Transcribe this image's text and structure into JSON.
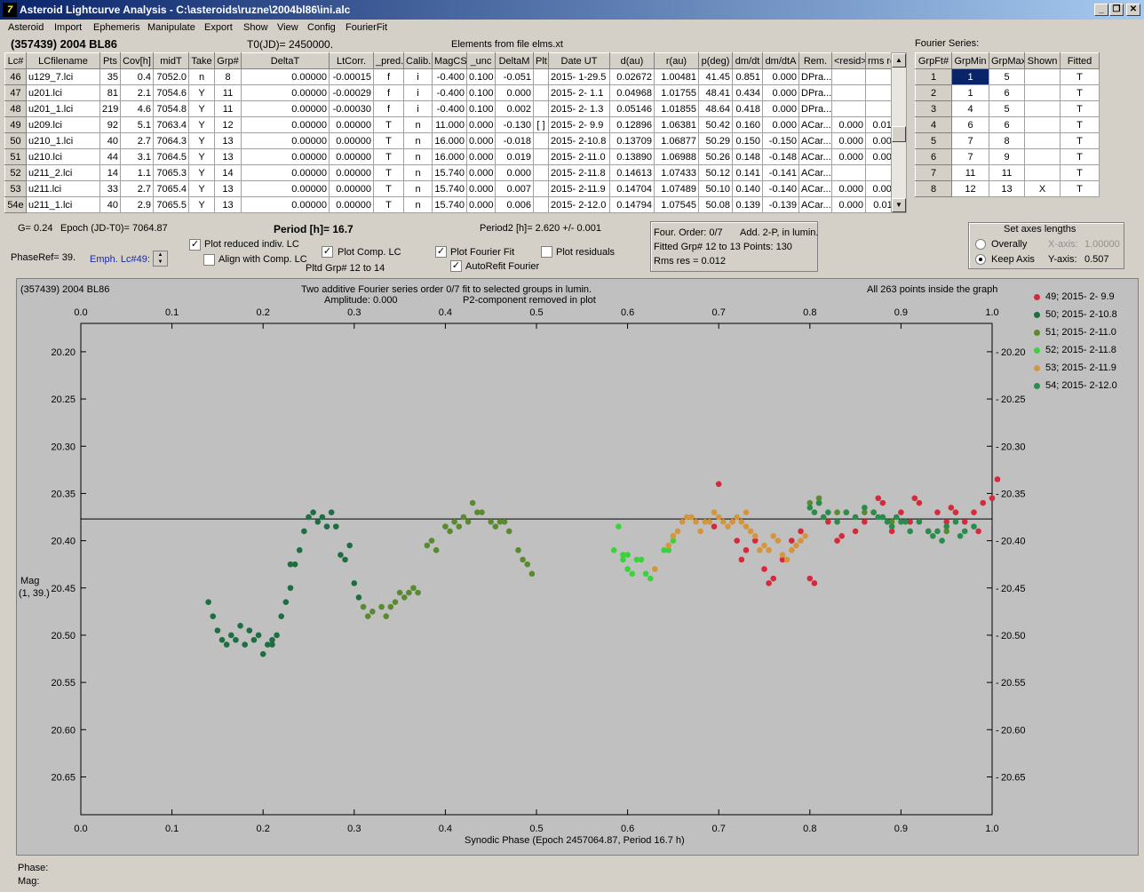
{
  "window": {
    "title": "Asteroid Lightcurve Analysis - C:\\asteroids\\ruzne\\2004bl86\\ini.alc",
    "icon": "app-icon"
  },
  "menu": [
    "Asteroid",
    "Import",
    "Ephemeris",
    "Manipulate",
    "Export",
    "Show",
    "View",
    "Config",
    "FourierFit"
  ],
  "header": {
    "asteroid": "(357439) 2004 BL86",
    "t0": "T0(JD)= 2450000.",
    "elements": "Elements from file elms.xt",
    "fourier_title": "Fourier Series:"
  },
  "lc_table": {
    "columns": [
      "Lc#",
      "LCfilename",
      "Pts",
      "Cov[h]",
      "midT",
      "Take",
      "Grp#",
      "DeltaT",
      "LtCorr.",
      "_pred.",
      "Calib.",
      "MagCS",
      "_unc",
      "DeltaM",
      "Plt",
      "Date UT",
      "d(au)",
      "r(au)",
      "p(deg)",
      "dm/dt",
      "dm/dtA",
      "Rem.",
      "<resid>",
      "rms res"
    ],
    "rows": [
      [
        "46",
        "u129_7.lci",
        "35",
        "0.4",
        "7052.0",
        "n",
        "8",
        "0.00000",
        "-0.00015",
        "f",
        "i",
        "-0.400",
        "0.100",
        "-0.051",
        "",
        "2015- 1-29.5",
        "0.02672",
        "1.00481",
        "41.45",
        "0.851",
        "0.000",
        "DPra...",
        "",
        ""
      ],
      [
        "47",
        "u201.lci",
        "81",
        "2.1",
        "7054.6",
        "Y",
        "11",
        "0.00000",
        "-0.00029",
        "f",
        "i",
        "-0.400",
        "0.100",
        "0.000",
        "",
        "2015- 2- 1.1",
        "0.04968",
        "1.01755",
        "48.41",
        "0.434",
        "0.000",
        "DPra...",
        "",
        ""
      ],
      [
        "48",
        "u201_1.lci",
        "219",
        "4.6",
        "7054.8",
        "Y",
        "11",
        "0.00000",
        "-0.00030",
        "f",
        "i",
        "-0.400",
        "0.100",
        "0.002",
        "",
        "2015- 2- 1.3",
        "0.05146",
        "1.01855",
        "48.64",
        "0.418",
        "0.000",
        "DPra...",
        "",
        ""
      ],
      [
        "49",
        "u209.lci",
        "92",
        "5.1",
        "7063.4",
        "Y",
        "12",
        "0.00000",
        "0.00000",
        "T",
        "n",
        "11.000",
        "0.000",
        "-0.130",
        "[ ]",
        "2015- 2- 9.9",
        "0.12896",
        "1.06381",
        "50.42",
        "0.160",
        "0.000",
        "ACar...",
        "0.000",
        "0.013"
      ],
      [
        "50",
        "u210_1.lci",
        "40",
        "2.7",
        "7064.3",
        "Y",
        "13",
        "0.00000",
        "0.00000",
        "T",
        "n",
        "16.000",
        "0.000",
        "-0.018",
        "",
        "2015- 2-10.8",
        "0.13709",
        "1.06877",
        "50.29",
        "0.150",
        "-0.150",
        "ACar...",
        "0.000",
        "0.002"
      ],
      [
        "51",
        "u210.lci",
        "44",
        "3.1",
        "7064.5",
        "Y",
        "13",
        "0.00000",
        "0.00000",
        "T",
        "n",
        "16.000",
        "0.000",
        "0.019",
        "",
        "2015- 2-11.0",
        "0.13890",
        "1.06988",
        "50.26",
        "0.148",
        "-0.148",
        "ACar...",
        "0.000",
        "0.007"
      ],
      [
        "52",
        "u211_2.lci",
        "14",
        "1.1",
        "7065.3",
        "Y",
        "14",
        "0.00000",
        "0.00000",
        "T",
        "n",
        "15.740",
        "0.000",
        "0.000",
        "",
        "2015- 2-11.8",
        "0.14613",
        "1.07433",
        "50.12",
        "0.141",
        "-0.141",
        "ACar...",
        "",
        ""
      ],
      [
        "53",
        "u211.lci",
        "33",
        "2.7",
        "7065.4",
        "Y",
        "13",
        "0.00000",
        "0.00000",
        "T",
        "n",
        "15.740",
        "0.000",
        "0.007",
        "",
        "2015- 2-11.9",
        "0.14704",
        "1.07489",
        "50.10",
        "0.140",
        "-0.140",
        "ACar...",
        "0.000",
        "0.007"
      ],
      [
        "54e",
        "u211_1.lci",
        "40",
        "2.9",
        "7065.5",
        "Y",
        "13",
        "0.00000",
        "0.00000",
        "T",
        "n",
        "15.740",
        "0.000",
        "0.006",
        "",
        "2015- 2-12.0",
        "0.14794",
        "1.07545",
        "50.08",
        "0.139",
        "-0.139",
        "ACar...",
        "0.000",
        "0.011"
      ]
    ]
  },
  "fourier_table": {
    "columns": [
      "GrpFt#",
      "GrpMin",
      "GrpMax",
      "Shown",
      "Fitted"
    ],
    "rows": [
      [
        "1",
        "1",
        "5",
        "",
        "T"
      ],
      [
        "2",
        "1",
        "6",
        "",
        "T"
      ],
      [
        "3",
        "4",
        "5",
        "",
        "T"
      ],
      [
        "4",
        "6",
        "6",
        "",
        "T"
      ],
      [
        "5",
        "7",
        "8",
        "",
        "T"
      ],
      [
        "6",
        "7",
        "9",
        "",
        "T"
      ],
      [
        "7",
        "11",
        "11",
        "",
        "T"
      ],
      [
        "8",
        "12",
        "13",
        "X",
        "T"
      ]
    ]
  },
  "controls": {
    "g": "G= 0.24",
    "epoch": "Epoch (JD-T0)= 7064.87",
    "period": "Period [h]= 16.7",
    "period2": "Period2 [h]= 2.620 +/- 0.001",
    "phaseref": "PhaseRef= 39.",
    "emph": "Emph. Lc#49:",
    "plot_reduced": "Plot reduced indiv. LC",
    "align": "Align with Comp. LC",
    "plot_comp": "Plot Comp. LC",
    "pltd_grp": "Pltd Grp#  12 to   14",
    "plot_fourier": "Plot Fourier Fit",
    "autorefit": "AutoRefit Fourier",
    "plot_resid": "Plot residuals",
    "four_order": "Four. Order:  0/7",
    "add2p": "Add. 2-P, in lumin.",
    "fitted_grp": "Fitted Grp# 12 to 13 Points: 130",
    "rms": "Rms res      = 0.012",
    "axes_title": "Set axes lengths",
    "overally": "Overally",
    "keep_axis": "Keep Axis",
    "xaxis_label": "X-axis:",
    "xaxis_value": "1.00000",
    "yaxis_label": "Y-axis:",
    "yaxis_value": "0.507"
  },
  "chart_data": {
    "type": "scatter",
    "title": "Two additive Fourier series order 0/7 fit to selected groups in lumin.",
    "subtitle1": "Amplitude: 0.000",
    "subtitle2": "P2-component removed in plot",
    "object": "(357439) 2004 BL86",
    "points_note": "All 263 points inside the graph",
    "xlabel": "Synodic Phase (Epoch 2457064.87, Period 16.7 h)",
    "ylabel": "Mag",
    "ylabel2": "(1, 39.)",
    "xlim": [
      0.0,
      1.0
    ],
    "ylim": [
      20.69,
      20.17
    ],
    "x_ticks": [
      "0.0",
      "0.1",
      "0.2",
      "0.3",
      "0.4",
      "0.5",
      "0.6",
      "0.7",
      "0.8",
      "0.9",
      "1.0"
    ],
    "y_ticks": [
      "20.20",
      "20.25",
      "20.30",
      "20.35",
      "20.40",
      "20.45",
      "20.50",
      "20.55",
      "20.60",
      "20.65"
    ],
    "fit_line": 20.377,
    "series": [
      {
        "name": "49; 2015- 2- 9.9",
        "color": "#d42a3c",
        "points": [
          [
            0.7,
            20.34
          ],
          [
            0.715,
            20.38
          ],
          [
            0.72,
            20.4
          ],
          [
            0.73,
            20.41
          ],
          [
            0.74,
            20.4
          ],
          [
            0.75,
            20.43
          ],
          [
            0.76,
            20.44
          ],
          [
            0.77,
            20.42
          ],
          [
            0.78,
            20.4
          ],
          [
            0.79,
            20.39
          ],
          [
            0.8,
            20.44
          ],
          [
            0.81,
            20.36
          ],
          [
            0.82,
            20.38
          ],
          [
            0.83,
            20.4
          ],
          [
            0.84,
            20.37
          ],
          [
            0.85,
            20.39
          ],
          [
            0.86,
            20.38
          ],
          [
            0.87,
            20.37
          ],
          [
            0.88,
            20.36
          ],
          [
            0.89,
            20.39
          ],
          [
            0.9,
            20.37
          ],
          [
            0.91,
            20.38
          ],
          [
            0.92,
            20.36
          ],
          [
            0.93,
            20.39
          ],
          [
            0.94,
            20.37
          ],
          [
            0.95,
            20.38
          ],
          [
            0.96,
            20.37
          ],
          [
            0.97,
            20.38
          ],
          [
            0.98,
            20.37
          ],
          [
            0.99,
            20.36
          ],
          [
            1.0,
            20.355
          ],
          [
            1.01,
            20.335
          ],
          [
            0.695,
            20.385
          ],
          [
            0.725,
            20.42
          ],
          [
            0.755,
            20.445
          ],
          [
            0.805,
            20.445
          ],
          [
            0.835,
            20.395
          ],
          [
            0.875,
            20.355
          ],
          [
            0.915,
            20.355
          ],
          [
            0.955,
            20.365
          ],
          [
            0.985,
            20.39
          ]
        ]
      },
      {
        "name": "50; 2015- 2-10.8",
        "color": "#1d6e40",
        "points": [
          [
            0.14,
            20.465
          ],
          [
            0.145,
            20.48
          ],
          [
            0.15,
            20.495
          ],
          [
            0.155,
            20.505
          ],
          [
            0.16,
            20.51
          ],
          [
            0.165,
            20.5
          ],
          [
            0.17,
            20.505
          ],
          [
            0.175,
            20.49
          ],
          [
            0.18,
            20.51
          ],
          [
            0.185,
            20.495
          ],
          [
            0.19,
            20.505
          ],
          [
            0.195,
            20.5
          ],
          [
            0.2,
            20.52
          ],
          [
            0.205,
            20.51
          ],
          [
            0.21,
            20.505
          ],
          [
            0.215,
            20.5
          ],
          [
            0.22,
            20.48
          ],
          [
            0.225,
            20.465
          ],
          [
            0.23,
            20.45
          ],
          [
            0.235,
            20.425
          ],
          [
            0.24,
            20.41
          ],
          [
            0.245,
            20.39
          ],
          [
            0.25,
            20.375
          ],
          [
            0.255,
            20.37
          ],
          [
            0.26,
            20.38
          ],
          [
            0.265,
            20.375
          ],
          [
            0.27,
            20.385
          ],
          [
            0.275,
            20.37
          ],
          [
            0.28,
            20.385
          ],
          [
            0.285,
            20.415
          ],
          [
            0.29,
            20.42
          ],
          [
            0.295,
            20.405
          ],
          [
            0.3,
            20.445
          ],
          [
            0.305,
            20.46
          ],
          [
            0.21,
            20.51
          ],
          [
            0.23,
            20.425
          ]
        ]
      },
      {
        "name": "51; 2015- 2-11.0",
        "color": "#5a8a30",
        "points": [
          [
            0.31,
            20.47
          ],
          [
            0.315,
            20.48
          ],
          [
            0.32,
            20.475
          ],
          [
            0.33,
            20.47
          ],
          [
            0.335,
            20.48
          ],
          [
            0.34,
            20.47
          ],
          [
            0.345,
            20.465
          ],
          [
            0.35,
            20.455
          ],
          [
            0.355,
            20.46
          ],
          [
            0.36,
            20.455
          ],
          [
            0.365,
            20.45
          ],
          [
            0.37,
            20.455
          ],
          [
            0.38,
            20.405
          ],
          [
            0.385,
            20.4
          ],
          [
            0.39,
            20.41
          ],
          [
            0.4,
            20.385
          ],
          [
            0.405,
            20.39
          ],
          [
            0.41,
            20.38
          ],
          [
            0.415,
            20.385
          ],
          [
            0.42,
            20.375
          ],
          [
            0.425,
            20.38
          ],
          [
            0.43,
            20.36
          ],
          [
            0.435,
            20.37
          ],
          [
            0.44,
            20.37
          ],
          [
            0.45,
            20.38
          ],
          [
            0.455,
            20.385
          ],
          [
            0.46,
            20.38
          ],
          [
            0.465,
            20.38
          ],
          [
            0.47,
            20.39
          ],
          [
            0.48,
            20.41
          ],
          [
            0.485,
            20.42
          ],
          [
            0.49,
            20.425
          ],
          [
            0.495,
            20.435
          ],
          [
            0.8,
            20.36
          ],
          [
            0.81,
            20.355
          ],
          [
            0.83,
            20.37
          ],
          [
            0.86,
            20.37
          ],
          [
            0.89,
            20.38
          ],
          [
            0.92,
            20.38
          ],
          [
            0.95,
            20.39
          ]
        ]
      },
      {
        "name": "52; 2015- 2-11.8",
        "color": "#3cd23c",
        "points": [
          [
            0.585,
            20.41
          ],
          [
            0.59,
            20.385
          ],
          [
            0.595,
            20.42
          ],
          [
            0.6,
            20.415
          ],
          [
            0.605,
            20.435
          ],
          [
            0.61,
            20.42
          ],
          [
            0.615,
            20.42
          ],
          [
            0.62,
            20.435
          ],
          [
            0.625,
            20.44
          ],
          [
            0.64,
            20.41
          ],
          [
            0.645,
            20.41
          ],
          [
            0.65,
            20.4
          ],
          [
            0.6,
            20.43
          ],
          [
            0.595,
            20.415
          ]
        ]
      },
      {
        "name": "53; 2015- 2-11.9",
        "color": "#d4963c",
        "points": [
          [
            0.63,
            20.43
          ],
          [
            0.645,
            20.405
          ],
          [
            0.65,
            20.395
          ],
          [
            0.655,
            20.39
          ],
          [
            0.66,
            20.38
          ],
          [
            0.665,
            20.375
          ],
          [
            0.67,
            20.375
          ],
          [
            0.675,
            20.38
          ],
          [
            0.68,
            20.39
          ],
          [
            0.685,
            20.38
          ],
          [
            0.69,
            20.38
          ],
          [
            0.695,
            20.37
          ],
          [
            0.7,
            20.375
          ],
          [
            0.705,
            20.38
          ],
          [
            0.71,
            20.385
          ],
          [
            0.715,
            20.38
          ],
          [
            0.72,
            20.375
          ],
          [
            0.725,
            20.38
          ],
          [
            0.73,
            20.385
          ],
          [
            0.735,
            20.39
          ],
          [
            0.74,
            20.395
          ],
          [
            0.745,
            20.41
          ],
          [
            0.75,
            20.405
          ],
          [
            0.755,
            20.41
          ],
          [
            0.76,
            20.395
          ],
          [
            0.765,
            20.4
          ],
          [
            0.77,
            20.415
          ],
          [
            0.775,
            20.42
          ],
          [
            0.78,
            20.41
          ],
          [
            0.785,
            20.405
          ],
          [
            0.79,
            20.4
          ],
          [
            0.795,
            20.395
          ],
          [
            0.73,
            20.37
          ]
        ]
      },
      {
        "name": "54; 2015- 2-12.0",
        "color": "#2a8c4a",
        "points": [
          [
            0.8,
            20.365
          ],
          [
            0.805,
            20.37
          ],
          [
            0.81,
            20.36
          ],
          [
            0.815,
            20.375
          ],
          [
            0.82,
            20.37
          ],
          [
            0.83,
            20.38
          ],
          [
            0.84,
            20.37
          ],
          [
            0.85,
            20.375
          ],
          [
            0.86,
            20.365
          ],
          [
            0.87,
            20.37
          ],
          [
            0.88,
            20.375
          ],
          [
            0.885,
            20.38
          ],
          [
            0.89,
            20.385
          ],
          [
            0.895,
            20.375
          ],
          [
            0.9,
            20.38
          ],
          [
            0.91,
            20.39
          ],
          [
            0.92,
            20.38
          ],
          [
            0.93,
            20.39
          ],
          [
            0.935,
            20.395
          ],
          [
            0.94,
            20.39
          ],
          [
            0.95,
            20.385
          ],
          [
            0.96,
            20.38
          ],
          [
            0.965,
            20.395
          ],
          [
            0.97,
            20.39
          ],
          [
            0.98,
            20.385
          ],
          [
            0.875,
            20.375
          ],
          [
            0.905,
            20.38
          ],
          [
            0.945,
            20.4
          ]
        ]
      }
    ]
  }
}
